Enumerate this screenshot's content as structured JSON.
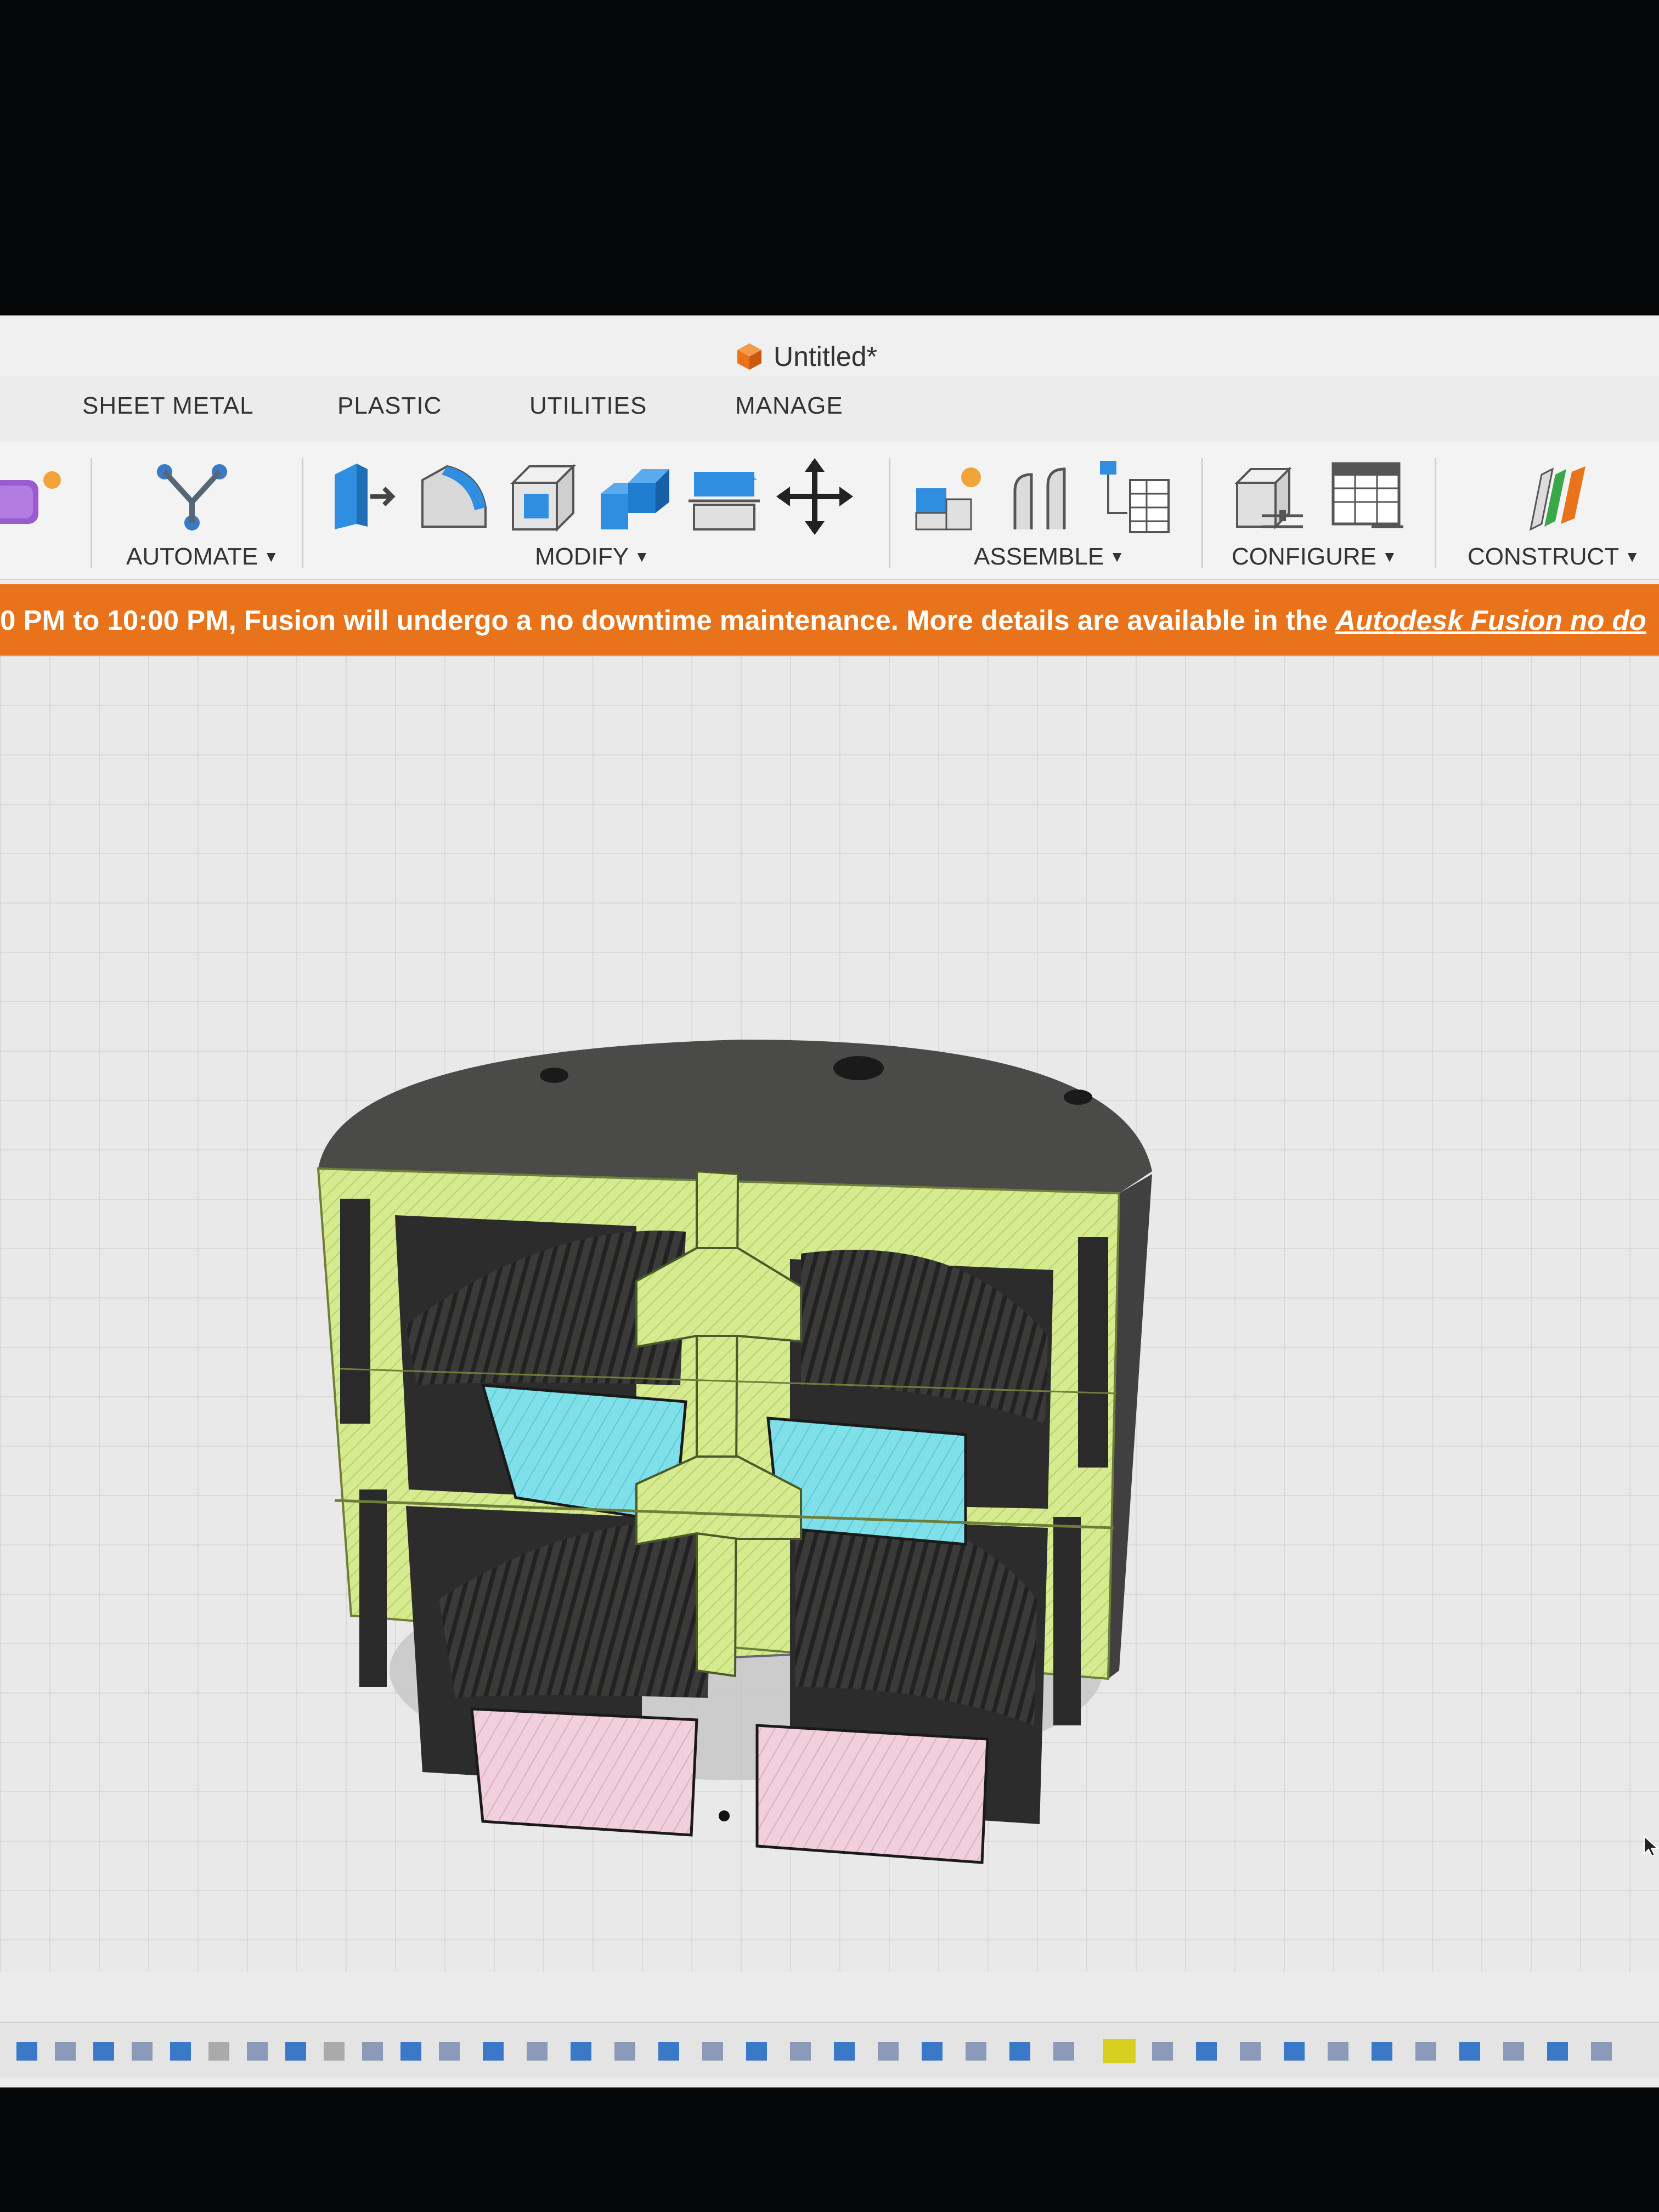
{
  "window": {
    "doc_title": "Untitled*",
    "app_icon": "fusion-cube-icon"
  },
  "tabs": [
    {
      "label": "SHEET METAL"
    },
    {
      "label": "PLASTIC"
    },
    {
      "label": "UTILITIES"
    },
    {
      "label": "MANAGE"
    }
  ],
  "ribbon": {
    "groups": {
      "automate": "AUTOMATE",
      "modify": "MODIFY",
      "assemble": "ASSEMBLE",
      "configure": "CONFIGURE",
      "construct": "CONSTRUCT"
    }
  },
  "banner": {
    "text": "0 PM to 10:00 PM, Fusion will undergo a no downtime maintenance. More details are available in the",
    "link_text": "Autodesk Fusion no do"
  },
  "colors": {
    "banner": "#e8731a",
    "section_fill": "#d6ea8f",
    "gear_section_top": "#7fe0ea",
    "gear_section_bottom": "#f1cfdc",
    "body_dark": "#4a4a48"
  }
}
